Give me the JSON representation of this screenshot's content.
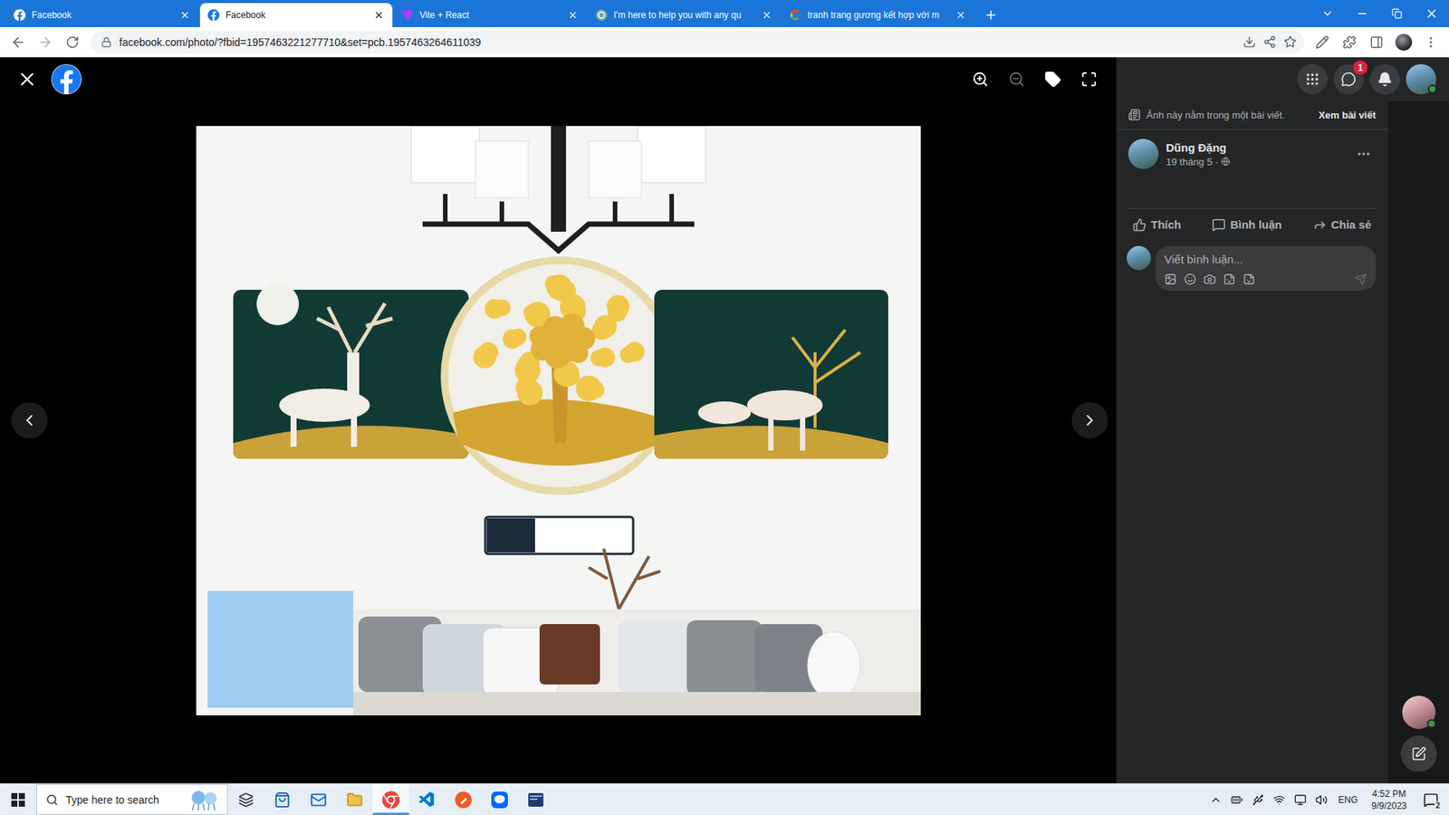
{
  "browser": {
    "tabs": [
      {
        "label": "Facebook",
        "selected": false,
        "kind": "facebook"
      },
      {
        "label": "Facebook",
        "selected": true,
        "kind": "facebook"
      },
      {
        "label": "Vite + React",
        "selected": false,
        "kind": "vite"
      },
      {
        "label": "I'm here to help you with any qu",
        "selected": false,
        "kind": "chat"
      },
      {
        "label": "tranh trang gương kết hợp với m",
        "selected": false,
        "kind": "google"
      }
    ],
    "url": "facebook.com/photo/?fbid=1957463221277710&set=pcb.1957463264611039"
  },
  "viewer_tools": [
    {
      "kind": "zoom-in",
      "disabled": false
    },
    {
      "kind": "zoom-out",
      "disabled": true
    },
    {
      "kind": "tag",
      "disabled": false
    },
    {
      "kind": "fullscreen",
      "disabled": false
    }
  ],
  "facebook": {
    "messenger_badge": "1",
    "post": {
      "notice": "Ảnh này nằm trong một bài viết.",
      "view_post": "Xem bài viết",
      "author": "Dũng Đặng",
      "date": "19 tháng 5 ·",
      "actions": [
        {
          "label": "Thích",
          "kind": "like"
        },
        {
          "label": "Bình luận",
          "kind": "comment"
        },
        {
          "label": "Chia sẻ",
          "kind": "share"
        }
      ],
      "comment_placeholder": "Viết bình luận..."
    }
  },
  "taskbar": {
    "search_placeholder": "Type here to search",
    "apps": [
      {
        "kind": "taskview",
        "active": false
      },
      {
        "kind": "store",
        "active": false
      },
      {
        "kind": "mail",
        "active": false
      },
      {
        "kind": "explorer",
        "active": false
      },
      {
        "kind": "chrome",
        "active": true
      },
      {
        "kind": "vscode",
        "active": false
      },
      {
        "kind": "postman",
        "active": false
      },
      {
        "kind": "zalo",
        "active": false
      },
      {
        "kind": "terminal",
        "active": false
      }
    ],
    "language": "ENG",
    "time": "4:52 PM",
    "date": "9/9/2023",
    "notifications": "2"
  }
}
